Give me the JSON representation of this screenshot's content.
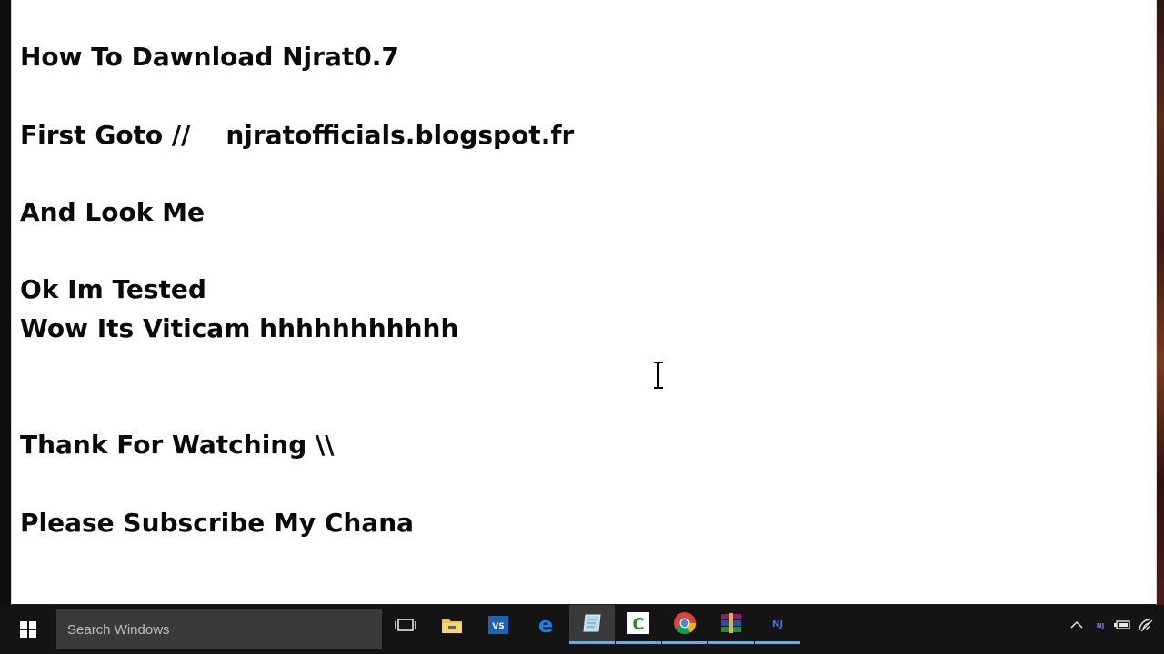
{
  "editor": {
    "lines": [
      "How To Dawnload Njrat0.7",
      "First Goto //    njratofficials.blogspot.fr",
      "And Look Me",
      "Ok Im Tested",
      "Wow Its Viticam hhhhhhhhhhh",
      "Thank For Watching \\\\",
      "Please Subscribe My Chana"
    ]
  },
  "taskbar": {
    "search_placeholder": "Search Windows",
    "apps": [
      {
        "icon": "task-view-icon"
      },
      {
        "icon": "file-explorer-icon"
      },
      {
        "icon": "visual-studio-icon",
        "text": "VS"
      },
      {
        "icon": "edge-icon",
        "text": "e"
      },
      {
        "icon": "notepad-icon"
      },
      {
        "icon": "camtasia-icon",
        "text": "C"
      },
      {
        "icon": "chrome-icon"
      },
      {
        "icon": "winrar-icon"
      },
      {
        "icon": "njrat-icon",
        "text": "NJ"
      }
    ],
    "tray": [
      {
        "icon": "show-hidden-icons-chevron-icon"
      },
      {
        "icon": "njrat-tray-icon",
        "text": "NJ"
      },
      {
        "icon": "battery-icon"
      },
      {
        "icon": "wifi-icon"
      }
    ]
  },
  "colors": {
    "taskbar": "#141414",
    "search_box": "#3a3a3a",
    "running_indicator": "#7aa6d6",
    "text": "#0a0a0a"
  }
}
